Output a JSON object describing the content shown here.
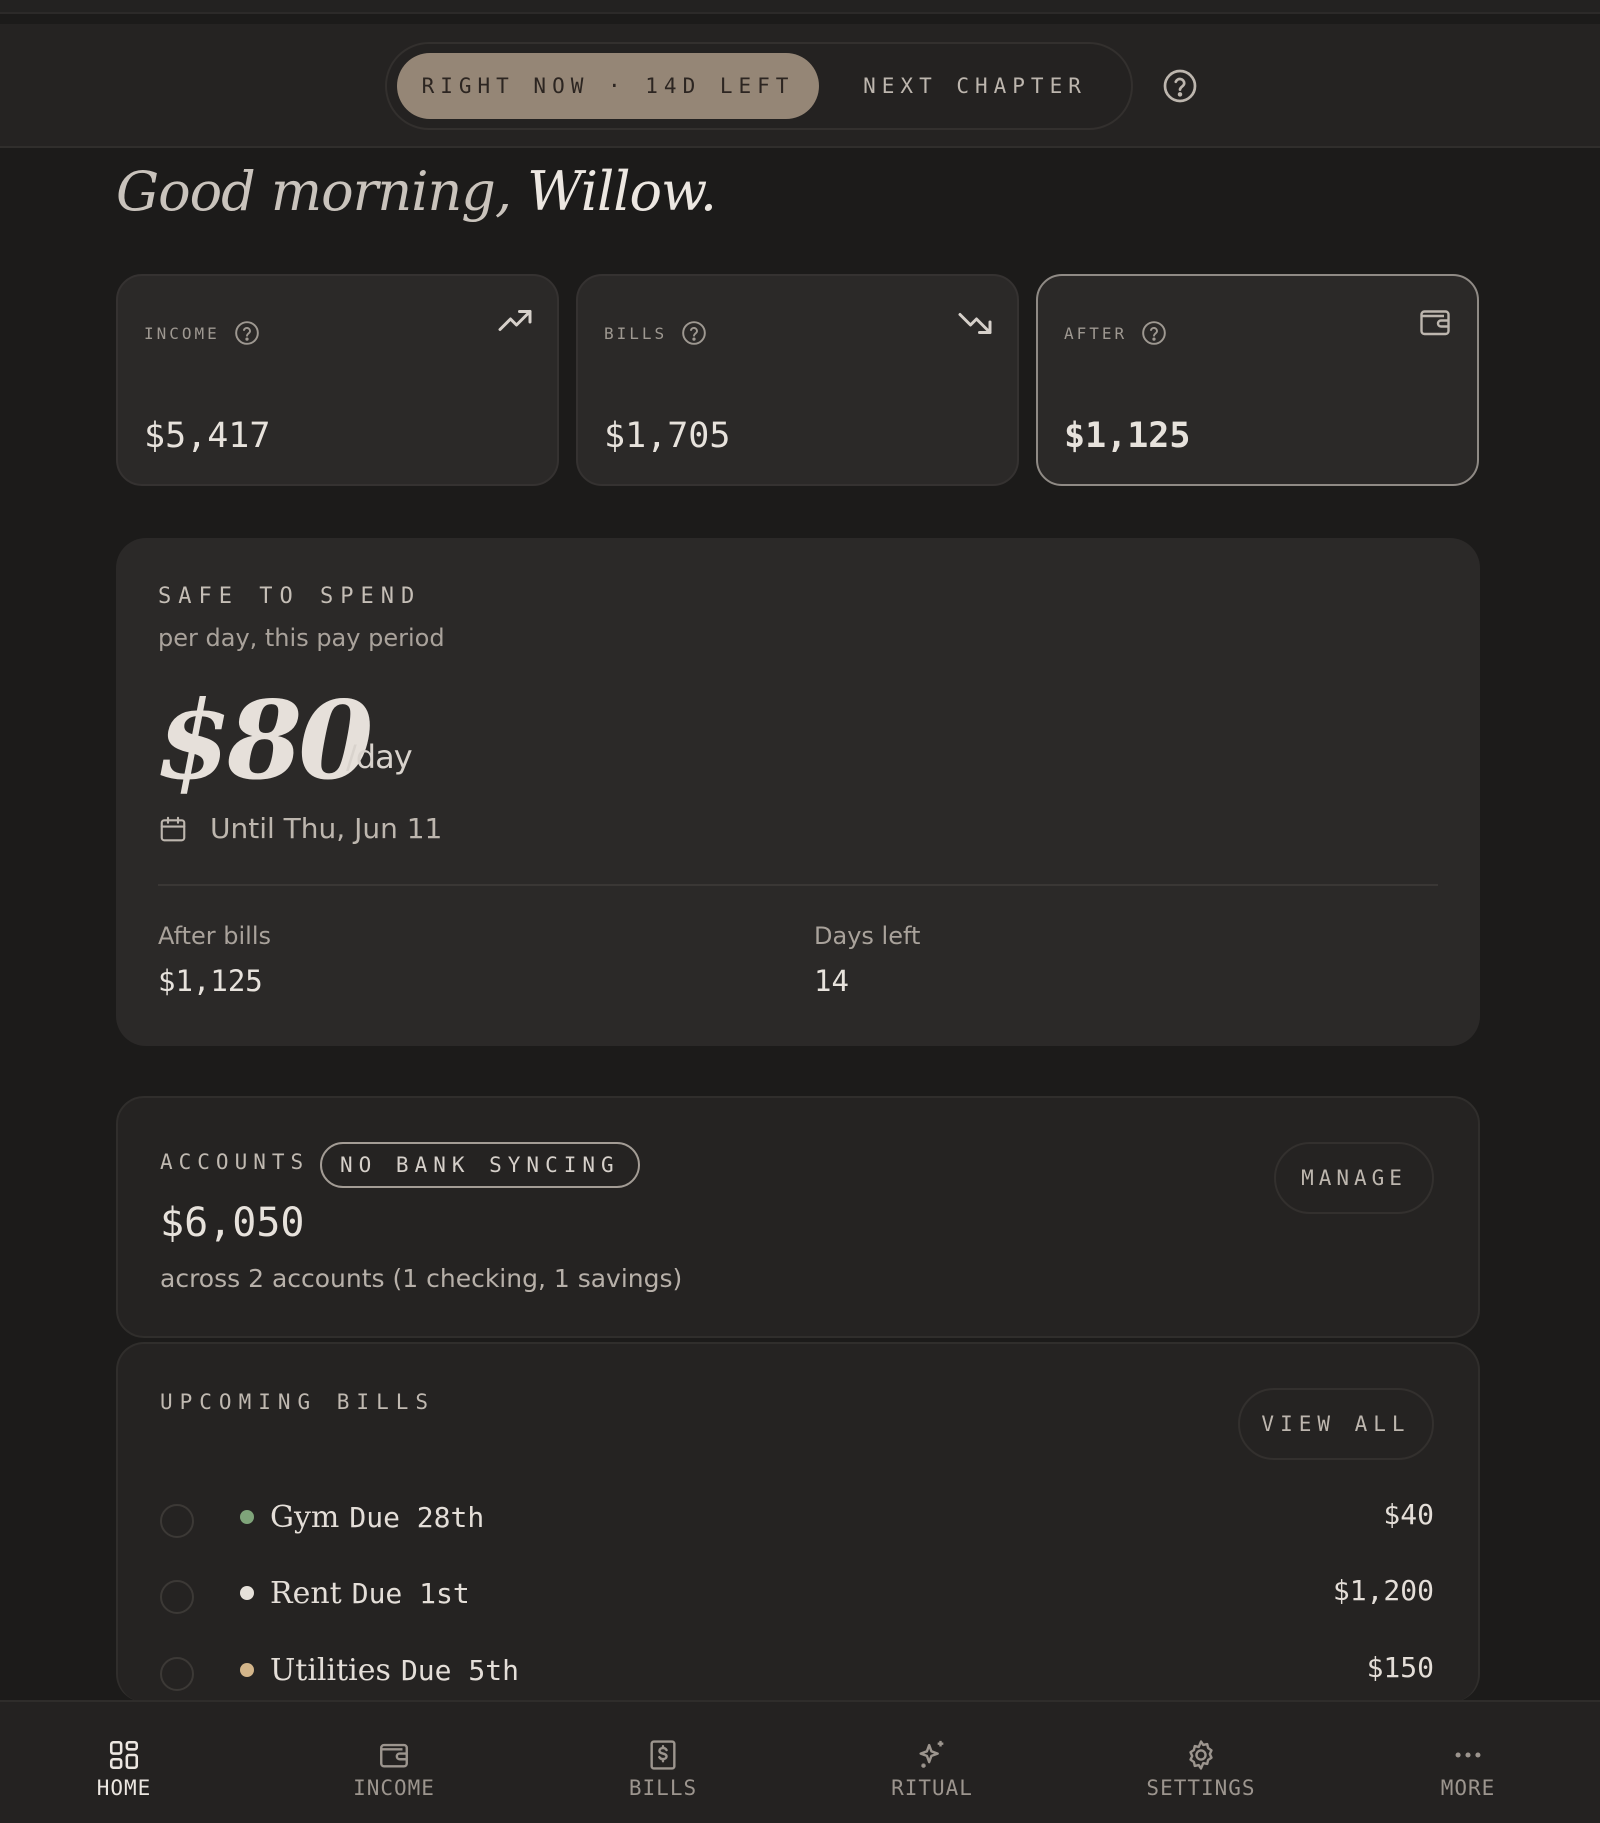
{
  "header": {
    "tab_active": "RIGHT NOW · 14D LEFT",
    "tab_next": "NEXT CHAPTER"
  },
  "greeting": {
    "prefix": "Good morning,",
    "name": "Willow."
  },
  "stats": [
    {
      "label": "INCOME",
      "value": "$5,417",
      "icon": "trending-up-icon"
    },
    {
      "label": "BILLS",
      "value": "$1,705",
      "icon": "trending-down-icon"
    },
    {
      "label": "AFTER",
      "value": "$1,125",
      "icon": "wallet-icon"
    }
  ],
  "safe": {
    "title": "SAFE TO SPEND",
    "subtitle": "per day, this pay period",
    "amount": "$80",
    "unit": "/day",
    "until": "Until Thu, Jun 11",
    "after_bills_label": "After bills",
    "after_bills_value": "$1,125",
    "days_left_label": "Days left",
    "days_left_value": "14"
  },
  "accounts": {
    "label": "ACCOUNTS",
    "badge": "NO BANK SYNCING",
    "manage_label": "MANAGE",
    "total": "$6,050",
    "summary": "across 2 accounts (1 checking, 1 savings)"
  },
  "bills": {
    "title": "UPCOMING BILLS",
    "view_all_label": "VIEW ALL",
    "items": [
      {
        "name": "Gym",
        "due": "Due 28th",
        "amount": "$40",
        "dot_color": "#7fa47a"
      },
      {
        "name": "Rent",
        "due": "Due 1st",
        "amount": "$1,200",
        "dot_color": "#e6e1da"
      },
      {
        "name": "Utilities",
        "due": "Due 5th",
        "amount": "$150",
        "dot_color": "#d3b58a"
      }
    ]
  },
  "nav": [
    {
      "label": "HOME",
      "icon": "grid-icon",
      "active": true
    },
    {
      "label": "INCOME",
      "icon": "wallet-icon",
      "active": false
    },
    {
      "label": "BILLS",
      "icon": "receipt-icon",
      "active": false
    },
    {
      "label": "RITUAL",
      "icon": "sparkles-icon",
      "active": false
    },
    {
      "label": "SETTINGS",
      "icon": "gear-icon",
      "active": false
    },
    {
      "label": "MORE",
      "icon": "more-icon",
      "active": false
    }
  ],
  "colors": {
    "background": "#1c1b1a",
    "card": "#2b2928",
    "accent_tab": "#958676"
  }
}
